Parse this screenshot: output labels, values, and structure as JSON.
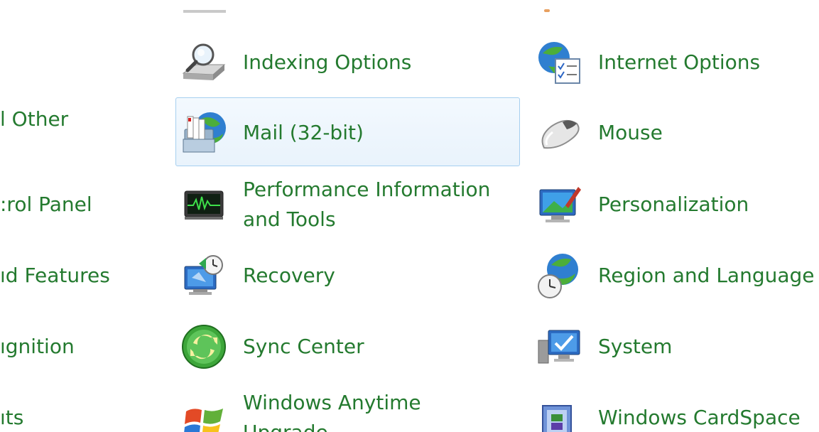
{
  "left_column": [
    {
      "label": "l Other"
    },
    {
      "label": ":rol Panel"
    },
    {
      "label": "ıd Features"
    },
    {
      "label": "ıgnition"
    },
    {
      "label": "ıts"
    }
  ],
  "middle_column": [
    {
      "icon": "indexing-options-icon",
      "lines": [
        "Indexing Options"
      ]
    },
    {
      "icon": "mail-icon",
      "lines": [
        "Mail (32-bit)"
      ],
      "selected": true
    },
    {
      "icon": "performance-icon",
      "lines": [
        "Performance Information",
        "and Tools"
      ]
    },
    {
      "icon": "recovery-icon",
      "lines": [
        "Recovery"
      ]
    },
    {
      "icon": "sync-center-icon",
      "lines": [
        "Sync Center"
      ]
    },
    {
      "icon": "windows-flag-icon",
      "lines": [
        "Windows Anytime",
        "Upgrade"
      ]
    }
  ],
  "right_column": [
    {
      "icon": "internet-options-icon",
      "lines": [
        "Internet Options"
      ]
    },
    {
      "icon": "mouse-icon",
      "lines": [
        "Mouse"
      ]
    },
    {
      "icon": "personalization-icon",
      "lines": [
        "Personalization"
      ]
    },
    {
      "icon": "region-language-icon",
      "lines": [
        "Region and Language"
      ]
    },
    {
      "icon": "system-icon",
      "lines": [
        "System"
      ]
    },
    {
      "icon": "cardspace-icon",
      "lines": [
        "Windows CardSpace"
      ]
    }
  ],
  "colors": {
    "link": "#247a2f",
    "selection_border": "#a6cff0",
    "selection_fill": "#eaf4fd"
  }
}
